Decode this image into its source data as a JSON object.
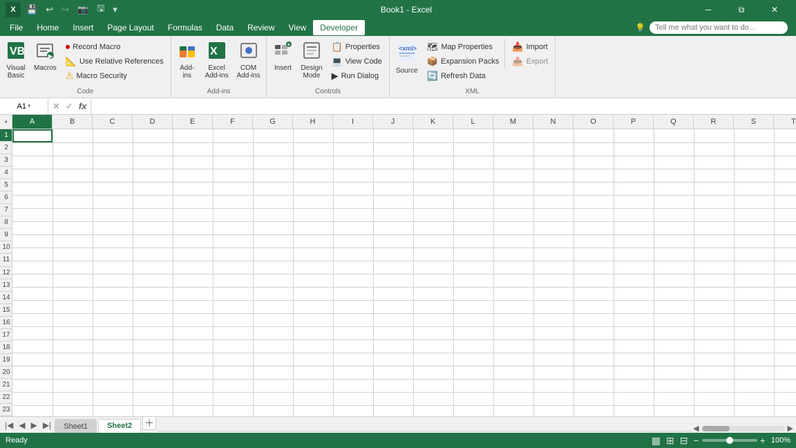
{
  "titlebar": {
    "title": "Book1 - Excel",
    "quicksave": "💾",
    "undo": "↩",
    "redo": "↪",
    "camera": "📷",
    "save2": "🖫",
    "more": "▾"
  },
  "menubar": {
    "items": [
      "File",
      "Home",
      "Insert",
      "Page Layout",
      "Formulas",
      "Data",
      "Review",
      "View",
      "Developer"
    ],
    "active": "Developer"
  },
  "search": {
    "placeholder": "Tell me what you want to do..."
  },
  "ribbon": {
    "groups": [
      {
        "label": "Code",
        "buttons": [
          {
            "icon": "▶",
            "label": "Visual\nBasic",
            "type": "large"
          },
          {
            "icon": "⏺",
            "label": "Macros",
            "type": "large"
          }
        ],
        "small_buttons": [
          {
            "icon": "⏺",
            "label": "Record Macro"
          },
          {
            "icon": "📐",
            "label": "Use Relative References"
          },
          {
            "icon": "🔒",
            "label": "Macro Security"
          }
        ]
      },
      {
        "label": "Add-ins",
        "buttons": [
          {
            "icon": "🔌",
            "label": "Add-ins",
            "type": "large"
          },
          {
            "icon": "📊",
            "label": "Excel\nAdd-ins",
            "type": "large"
          },
          {
            "icon": "🧩",
            "label": "COM\nAdd-ins",
            "type": "large"
          }
        ]
      },
      {
        "label": "Controls",
        "buttons": [
          {
            "icon": "➕",
            "label": "Insert",
            "type": "large"
          },
          {
            "icon": "✏️",
            "label": "Design\nMode",
            "type": "large"
          }
        ],
        "small_buttons": [
          {
            "icon": "📋",
            "label": "Properties"
          },
          {
            "icon": "💻",
            "label": "View Code"
          },
          {
            "icon": "▶",
            "label": "Run Dialog"
          }
        ]
      },
      {
        "label": "XML",
        "buttons": [
          {
            "icon": "🗺",
            "label": "Source",
            "type": "large"
          }
        ],
        "small_buttons": [
          {
            "icon": "🗺",
            "label": "Map Properties"
          },
          {
            "icon": "📦",
            "label": "Expansion Packs"
          },
          {
            "icon": "🔄",
            "label": "Refresh Data"
          },
          {
            "icon": "📥",
            "label": "Import"
          },
          {
            "icon": "📤",
            "label": "Export"
          }
        ]
      }
    ]
  },
  "formulabar": {
    "namebox": "A1",
    "cancel_icon": "✕",
    "confirm_icon": "✓",
    "function_icon": "fx",
    "value": ""
  },
  "columns": [
    "A",
    "B",
    "C",
    "D",
    "E",
    "F",
    "G",
    "H",
    "I",
    "J",
    "K",
    "L",
    "M",
    "N",
    "O",
    "P",
    "Q",
    "R",
    "S",
    "T"
  ],
  "rows": [
    1,
    2,
    3,
    4,
    5,
    6,
    7,
    8,
    9,
    10,
    11,
    12,
    13,
    14,
    15,
    16,
    17,
    18,
    19,
    20,
    21,
    22,
    23
  ],
  "active_cell": "A1",
  "sheets": [
    {
      "name": "Sheet1",
      "active": false
    },
    {
      "name": "Sheet2",
      "active": true
    }
  ],
  "statusbar": {
    "ready": "Ready",
    "zoom": "100%"
  }
}
